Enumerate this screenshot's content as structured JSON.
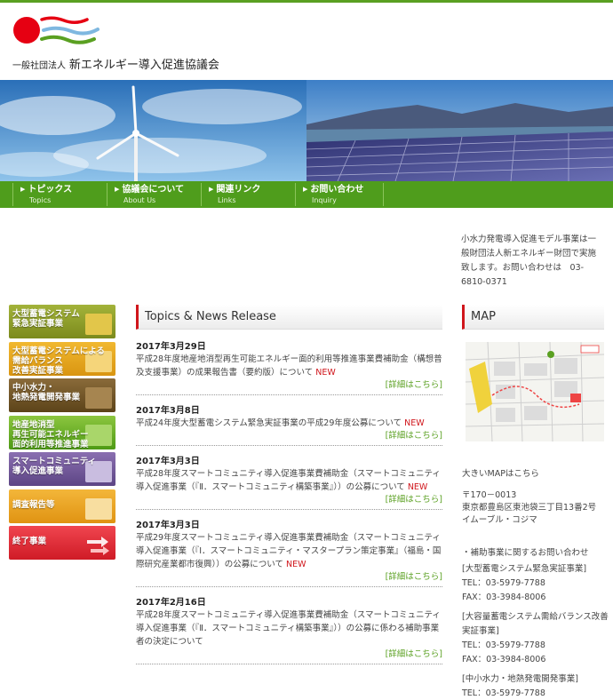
{
  "org": {
    "type": "一般社団法人",
    "name": "新エネルギー導入促進協議会"
  },
  "nav": [
    {
      "jp": "トピックス",
      "en": "Topics"
    },
    {
      "jp": "協議会について",
      "en": "About Us"
    },
    {
      "jp": "関連リンク",
      "en": "Links"
    },
    {
      "jp": "お問い合わせ",
      "en": "Inquiry"
    }
  ],
  "contact_note": "小水力発電導入促進モデル事業は一般財団法人新エネルギー財団で実施致します。お問い合わせは　03-6810-0371",
  "sidebar": [
    "大型蓄電システム\n緊急実証事業",
    "大型蓄電システムによる\n需給バランス\n改善実証事業",
    "中小水力・\n地熱発電開発事業",
    "地産地消型\n再生可能エネルギー\n面的利用等推進事業",
    "スマートコミュニティ\n導入促進事業",
    "調査報告等",
    "終了事業"
  ],
  "topics": {
    "heading": "Topics & News  Release",
    "more_label": "[詳細はこちら]",
    "new_label": "NEW",
    "items": [
      {
        "date": "2017年3月29日",
        "text": "平成28年度地産地消型再生可能エネルギー面的利用等推進事業費補助金（構想普及支援事業）の成果報告書（要約版）について",
        "new": true
      },
      {
        "date": "2017年3月8日",
        "text": "平成24年度大型蓄電システム緊急実証事業の平成29年度公募について",
        "new": true
      },
      {
        "date": "2017年3月3日",
        "text": "平成28年度スマートコミュニティ導入促進事業費補助金（スマートコミュニティ導入促進事業（『Ⅱ．スマートコミュニティ構築事業』））の公募について",
        "new": true
      },
      {
        "date": "2017年3月3日",
        "text": "平成29年度スマートコミュニティ導入促進事業費補助金（スマートコミュニティ導入促進事業（『Ⅰ．スマートコミュニティ・マスタープラン策定事業』（福島・国際研究産業都市復興））の公募について",
        "new": true
      },
      {
        "date": "2017年2月16日",
        "text": "平成28年度スマートコミュニティ導入促進事業費補助金（スマートコミュニティ導入促進事業（『Ⅱ．スマートコミュニティ構築事業』））の公募に係わる補助事業者の決定について",
        "new": false
      }
    ]
  },
  "map": {
    "heading": "MAP",
    "link": "大きいMAPはこちら"
  },
  "address": {
    "zip": "〒170－0013",
    "street": "東京都豊島区東池袋三丁目13番2号",
    "building": "イムーブル・コジマ"
  },
  "contacts": {
    "intro": "・補助事業に関するお問い合わせ",
    "groups": [
      {
        "name": "[大型蓄電システム緊急実証事業]",
        "tel": "TEL：03-5979-7788",
        "fax": "FAX：03-3984-8006"
      },
      {
        "name": "[大容量蓄電システム需給バランス改善実証事業]",
        "tel": "TEL：03-5979-7788",
        "fax": "FAX：03-3984-8006"
      },
      {
        "name": "[中小水力・地熱発電開発事業]",
        "tel": "TEL：03-5979-7788",
        "fax": ""
      }
    ]
  },
  "colors": {
    "brand_green": "#4f9d1c",
    "accent_red": "#d0161c"
  }
}
